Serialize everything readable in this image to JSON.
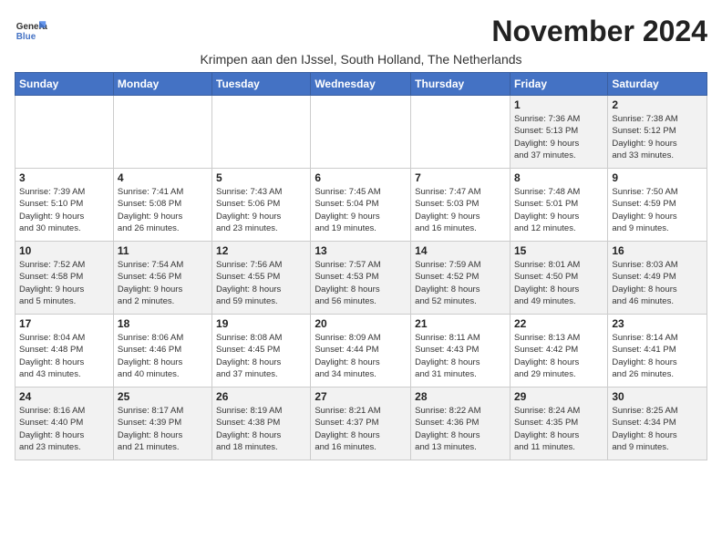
{
  "header": {
    "title": "November 2024",
    "location": "Krimpen aan den IJssel, South Holland, The Netherlands",
    "logo_line1": "General",
    "logo_line2": "Blue"
  },
  "days_of_week": [
    "Sunday",
    "Monday",
    "Tuesday",
    "Wednesday",
    "Thursday",
    "Friday",
    "Saturday"
  ],
  "weeks": [
    [
      {
        "day": "",
        "info": ""
      },
      {
        "day": "",
        "info": ""
      },
      {
        "day": "",
        "info": ""
      },
      {
        "day": "",
        "info": ""
      },
      {
        "day": "",
        "info": ""
      },
      {
        "day": "1",
        "info": "Sunrise: 7:36 AM\nSunset: 5:13 PM\nDaylight: 9 hours\nand 37 minutes."
      },
      {
        "day": "2",
        "info": "Sunrise: 7:38 AM\nSunset: 5:12 PM\nDaylight: 9 hours\nand 33 minutes."
      }
    ],
    [
      {
        "day": "3",
        "info": "Sunrise: 7:39 AM\nSunset: 5:10 PM\nDaylight: 9 hours\nand 30 minutes."
      },
      {
        "day": "4",
        "info": "Sunrise: 7:41 AM\nSunset: 5:08 PM\nDaylight: 9 hours\nand 26 minutes."
      },
      {
        "day": "5",
        "info": "Sunrise: 7:43 AM\nSunset: 5:06 PM\nDaylight: 9 hours\nand 23 minutes."
      },
      {
        "day": "6",
        "info": "Sunrise: 7:45 AM\nSunset: 5:04 PM\nDaylight: 9 hours\nand 19 minutes."
      },
      {
        "day": "7",
        "info": "Sunrise: 7:47 AM\nSunset: 5:03 PM\nDaylight: 9 hours\nand 16 minutes."
      },
      {
        "day": "8",
        "info": "Sunrise: 7:48 AM\nSunset: 5:01 PM\nDaylight: 9 hours\nand 12 minutes."
      },
      {
        "day": "9",
        "info": "Sunrise: 7:50 AM\nSunset: 4:59 PM\nDaylight: 9 hours\nand 9 minutes."
      }
    ],
    [
      {
        "day": "10",
        "info": "Sunrise: 7:52 AM\nSunset: 4:58 PM\nDaylight: 9 hours\nand 5 minutes."
      },
      {
        "day": "11",
        "info": "Sunrise: 7:54 AM\nSunset: 4:56 PM\nDaylight: 9 hours\nand 2 minutes."
      },
      {
        "day": "12",
        "info": "Sunrise: 7:56 AM\nSunset: 4:55 PM\nDaylight: 8 hours\nand 59 minutes."
      },
      {
        "day": "13",
        "info": "Sunrise: 7:57 AM\nSunset: 4:53 PM\nDaylight: 8 hours\nand 56 minutes."
      },
      {
        "day": "14",
        "info": "Sunrise: 7:59 AM\nSunset: 4:52 PM\nDaylight: 8 hours\nand 52 minutes."
      },
      {
        "day": "15",
        "info": "Sunrise: 8:01 AM\nSunset: 4:50 PM\nDaylight: 8 hours\nand 49 minutes."
      },
      {
        "day": "16",
        "info": "Sunrise: 8:03 AM\nSunset: 4:49 PM\nDaylight: 8 hours\nand 46 minutes."
      }
    ],
    [
      {
        "day": "17",
        "info": "Sunrise: 8:04 AM\nSunset: 4:48 PM\nDaylight: 8 hours\nand 43 minutes."
      },
      {
        "day": "18",
        "info": "Sunrise: 8:06 AM\nSunset: 4:46 PM\nDaylight: 8 hours\nand 40 minutes."
      },
      {
        "day": "19",
        "info": "Sunrise: 8:08 AM\nSunset: 4:45 PM\nDaylight: 8 hours\nand 37 minutes."
      },
      {
        "day": "20",
        "info": "Sunrise: 8:09 AM\nSunset: 4:44 PM\nDaylight: 8 hours\nand 34 minutes."
      },
      {
        "day": "21",
        "info": "Sunrise: 8:11 AM\nSunset: 4:43 PM\nDaylight: 8 hours\nand 31 minutes."
      },
      {
        "day": "22",
        "info": "Sunrise: 8:13 AM\nSunset: 4:42 PM\nDaylight: 8 hours\nand 29 minutes."
      },
      {
        "day": "23",
        "info": "Sunrise: 8:14 AM\nSunset: 4:41 PM\nDaylight: 8 hours\nand 26 minutes."
      }
    ],
    [
      {
        "day": "24",
        "info": "Sunrise: 8:16 AM\nSunset: 4:40 PM\nDaylight: 8 hours\nand 23 minutes."
      },
      {
        "day": "25",
        "info": "Sunrise: 8:17 AM\nSunset: 4:39 PM\nDaylight: 8 hours\nand 21 minutes."
      },
      {
        "day": "26",
        "info": "Sunrise: 8:19 AM\nSunset: 4:38 PM\nDaylight: 8 hours\nand 18 minutes."
      },
      {
        "day": "27",
        "info": "Sunrise: 8:21 AM\nSunset: 4:37 PM\nDaylight: 8 hours\nand 16 minutes."
      },
      {
        "day": "28",
        "info": "Sunrise: 8:22 AM\nSunset: 4:36 PM\nDaylight: 8 hours\nand 13 minutes."
      },
      {
        "day": "29",
        "info": "Sunrise: 8:24 AM\nSunset: 4:35 PM\nDaylight: 8 hours\nand 11 minutes."
      },
      {
        "day": "30",
        "info": "Sunrise: 8:25 AM\nSunset: 4:34 PM\nDaylight: 8 hours\nand 9 minutes."
      }
    ]
  ]
}
